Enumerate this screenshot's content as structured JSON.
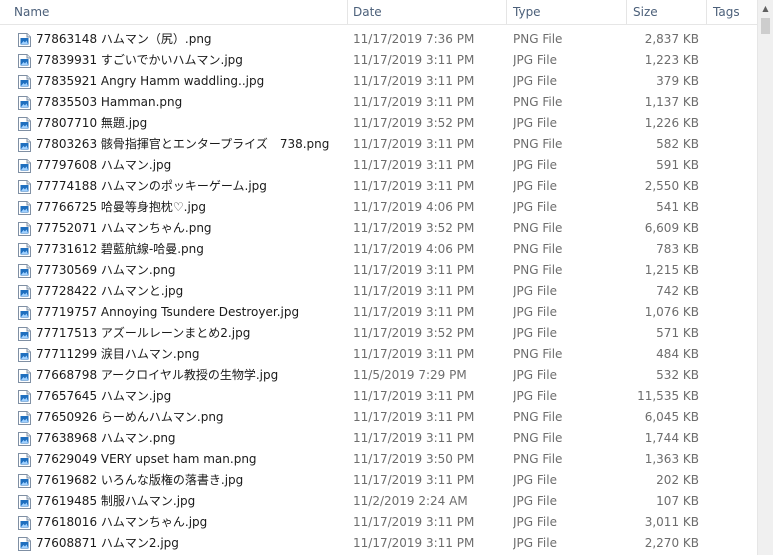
{
  "columns": {
    "name": "Name",
    "date": "Date",
    "type": "Type",
    "size": "Size",
    "tags": "Tags"
  },
  "file_icon": "image-file-icon",
  "files": [
    {
      "name": "77863148 ハムマン（尻）.png",
      "date": "11/17/2019 7:36 PM",
      "type": "PNG File",
      "size": "2,837 KB"
    },
    {
      "name": "77839931 すごいでかいハムマン.jpg",
      "date": "11/17/2019 3:11 PM",
      "type": "JPG File",
      "size": "1,223 KB"
    },
    {
      "name": "77835921 Angry Hamm waddling..jpg",
      "date": "11/17/2019 3:11 PM",
      "type": "JPG File",
      "size": "379 KB"
    },
    {
      "name": "77835503 Hamman.png",
      "date": "11/17/2019 3:11 PM",
      "type": "PNG File",
      "size": "1,137 KB"
    },
    {
      "name": "77807710 無題.jpg",
      "date": "11/17/2019 3:52 PM",
      "type": "JPG File",
      "size": "1,226 KB"
    },
    {
      "name": "77803263 骸骨指揮官とエンタープライズ　738.png",
      "date": "11/17/2019 3:11 PM",
      "type": "PNG File",
      "size": "582 KB"
    },
    {
      "name": "77797608 ハムマン.jpg",
      "date": "11/17/2019 3:11 PM",
      "type": "JPG File",
      "size": "591 KB"
    },
    {
      "name": "77774188 ハムマンのポッキーゲーム.jpg",
      "date": "11/17/2019 3:11 PM",
      "type": "JPG File",
      "size": "2,550 KB"
    },
    {
      "name": "77766725 哈曼等身抱枕♡.jpg",
      "date": "11/17/2019 4:06 PM",
      "type": "JPG File",
      "size": "541 KB"
    },
    {
      "name": "77752071 ハムマンちゃん.png",
      "date": "11/17/2019 3:52 PM",
      "type": "PNG File",
      "size": "6,609 KB"
    },
    {
      "name": "77731612 碧藍航線-哈曼.png",
      "date": "11/17/2019 4:06 PM",
      "type": "PNG File",
      "size": "783 KB"
    },
    {
      "name": "77730569 ハムマン.png",
      "date": "11/17/2019 3:11 PM",
      "type": "PNG File",
      "size": "1,215 KB"
    },
    {
      "name": "77728422 ハムマンと.jpg",
      "date": "11/17/2019 3:11 PM",
      "type": "JPG File",
      "size": "742 KB"
    },
    {
      "name": "77719757 Annoying Tsundere Destroyer.jpg",
      "date": "11/17/2019 3:11 PM",
      "type": "JPG File",
      "size": "1,076 KB"
    },
    {
      "name": "77717513 アズールレーンまとめ2.jpg",
      "date": "11/17/2019 3:52 PM",
      "type": "JPG File",
      "size": "571 KB"
    },
    {
      "name": "77711299 涙目ハムマン.png",
      "date": "11/17/2019 3:11 PM",
      "type": "PNG File",
      "size": "484 KB"
    },
    {
      "name": "77668798 アークロイヤル教授の生物学.jpg",
      "date": "11/5/2019 7:29 PM",
      "type": "JPG File",
      "size": "532 KB"
    },
    {
      "name": "77657645 ハムマン.jpg",
      "date": "11/17/2019 3:11 PM",
      "type": "JPG File",
      "size": "11,535 KB"
    },
    {
      "name": "77650926 らーめんハムマン.png",
      "date": "11/17/2019 3:11 PM",
      "type": "PNG File",
      "size": "6,045 KB"
    },
    {
      "name": "77638968 ハムマン.png",
      "date": "11/17/2019 3:11 PM",
      "type": "PNG File",
      "size": "1,744 KB"
    },
    {
      "name": "77629049 VERY upset ham man.png",
      "date": "11/17/2019 3:50 PM",
      "type": "PNG File",
      "size": "1,363 KB"
    },
    {
      "name": "77619682 いろんな版権の落書き.jpg",
      "date": "11/17/2019 3:11 PM",
      "type": "JPG File",
      "size": "202 KB"
    },
    {
      "name": "77619485 制服ハムマン.jpg",
      "date": "11/2/2019 2:24 AM",
      "type": "JPG File",
      "size": "107 KB"
    },
    {
      "name": "77618016 ハムマンちゃん.jpg",
      "date": "11/17/2019 3:11 PM",
      "type": "JPG File",
      "size": "3,011 KB"
    },
    {
      "name": "77608871 ハムマン2.jpg",
      "date": "11/17/2019 3:11 PM",
      "type": "JPG File",
      "size": "2,270 KB"
    }
  ],
  "colors": {
    "header_text": "#4c607a",
    "name_text": "#1a1a1a",
    "meta_text": "#6d6d6d",
    "icon_blue": "#1f6fbf"
  }
}
